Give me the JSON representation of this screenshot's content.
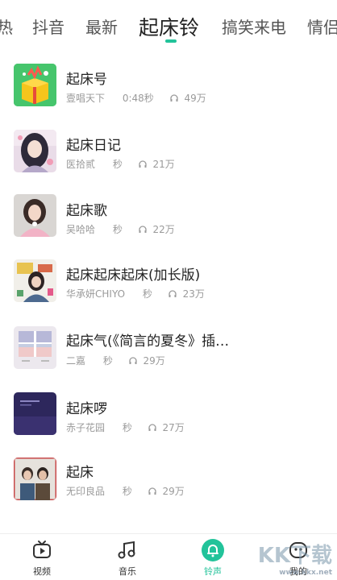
{
  "tabs": [
    "热",
    "抖音",
    "最新",
    "起床铃",
    "搞笑来电",
    "情侣"
  ],
  "active_tab": "起床铃",
  "colors": {
    "accent": "#22c39a"
  },
  "songs": [
    {
      "title": "起床号",
      "artist": "壹唱天下",
      "duration": "0:48秒",
      "plays": "49万"
    },
    {
      "title": "起床日记",
      "artist": "医拾贰",
      "duration": "秒",
      "plays": "21万"
    },
    {
      "title": "起床歌",
      "artist": "吴哈哈",
      "duration": "秒",
      "plays": "22万"
    },
    {
      "title": "起床起床起床(加长版)",
      "artist": "华承妍CHIYO",
      "duration": "秒",
      "plays": "23万"
    },
    {
      "title": "起床气(《简言的夏冬》插…",
      "artist": "二嘉",
      "duration": "秒",
      "plays": "29万"
    },
    {
      "title": "起床啰",
      "artist": "赤子花园",
      "duration": "秒",
      "plays": "27万"
    },
    {
      "title": "起床",
      "artist": "无印良品",
      "duration": "秒",
      "plays": "29万"
    }
  ],
  "nav": [
    {
      "label": "视频",
      "icon": "tv-icon"
    },
    {
      "label": "音乐",
      "icon": "music-note-icon"
    },
    {
      "label": "铃声",
      "icon": "bell-icon"
    },
    {
      "label": "我的",
      "icon": "profile-icon"
    }
  ],
  "watermark": {
    "text": "KK下载",
    "url": "www.kkx.net"
  }
}
